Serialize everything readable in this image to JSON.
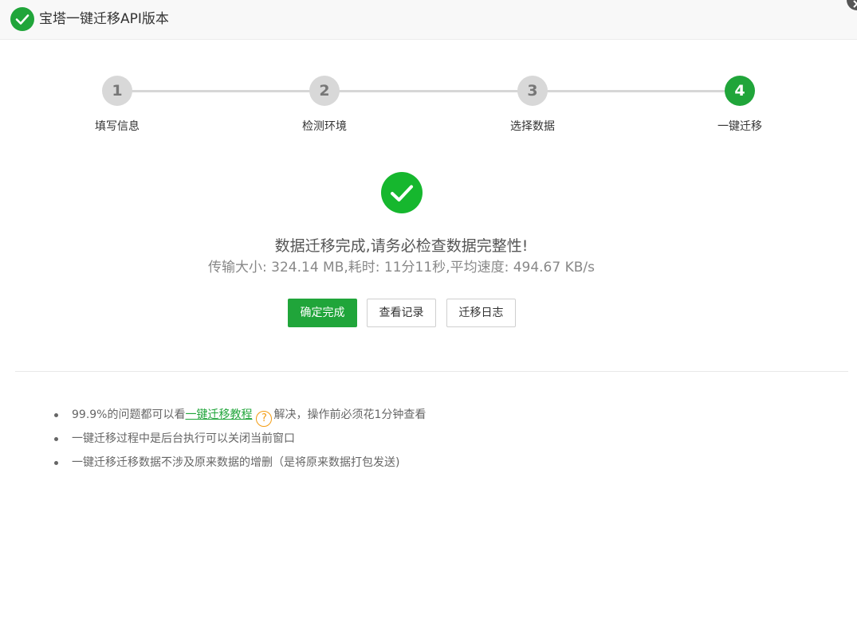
{
  "window": {
    "title": "宝塔一键迁移API版本",
    "logo_icon": "check-circle-icon",
    "close_icon": "close-icon",
    "accent_color": "#20a53a"
  },
  "steps": [
    {
      "number": "1",
      "label": "填写信息",
      "state": "done"
    },
    {
      "number": "2",
      "label": "检测环境",
      "state": "done"
    },
    {
      "number": "3",
      "label": "选择数据",
      "state": "done"
    },
    {
      "number": "4",
      "label": "一键迁移",
      "state": "active"
    }
  ],
  "result": {
    "icon": "success-check-icon",
    "title": "数据迁移完成,请务必检查数据完整性!",
    "stats": "传输大小: 324.14 MB,耗时: 11分11秒,平均速度: 494.67 KB/s"
  },
  "actions": {
    "confirm_label": "确定完成",
    "records_label": "查看记录",
    "log_label": "迁移日志"
  },
  "tips": {
    "tip1_prefix": "99.9%的问题都可以看",
    "tip1_link": "一键迁移教程",
    "tip1_help_glyph": "?",
    "tip1_suffix": "解决，操作前必须花1分钟查看",
    "tip2": "一键迁移过程中是后台执行可以关闭当前窗口",
    "tip3": "一键迁移迁移数据不涉及原来数据的增删（是将原来数据打包发送)"
  }
}
